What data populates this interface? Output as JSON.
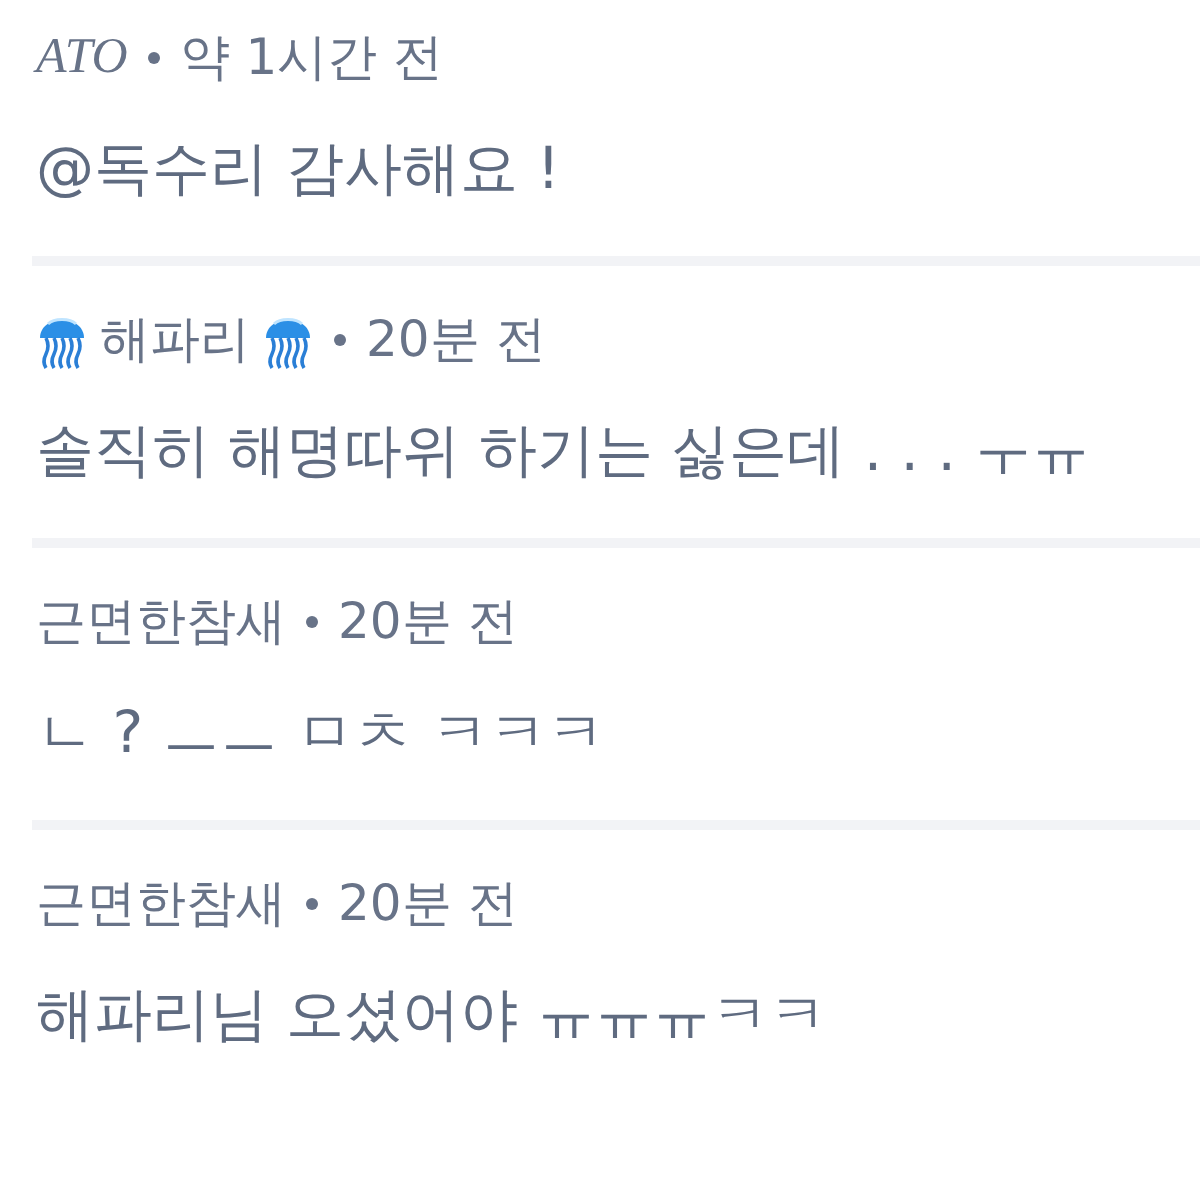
{
  "comments": [
    {
      "kind": "italic",
      "author": "ATO",
      "time": "약 1시간 전",
      "body": "@독수리 감사해요 !"
    },
    {
      "kind": "jellyfish",
      "author": "해파리",
      "time": "20분 전",
      "body": "솔직히 해명따위 하기는 싫은데 . . . ㅜㅠ"
    },
    {
      "kind": "plain",
      "author": "근면한참새",
      "time": "20분 전",
      "body": "ㄴ ? ㅡㅡ ㅁㅊ ㅋㅋㅋ"
    },
    {
      "kind": "plain",
      "author": "근면한참새",
      "time": "20분 전",
      "body": "해파리님 오셨어야 ㅠㅠㅠㅋㅋ"
    }
  ]
}
